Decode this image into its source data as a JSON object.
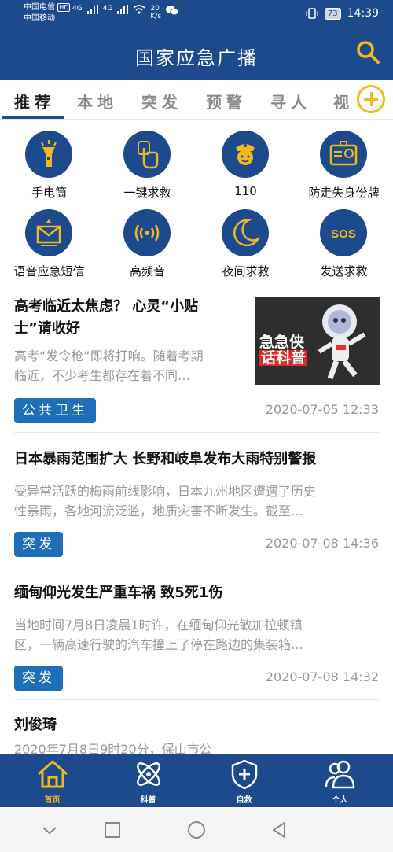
{
  "status_bar": {
    "carrier1": "中国电信",
    "carrier1_badge": "HD",
    "carrier2": "中国移动",
    "network1": "4G",
    "network2": "4G",
    "speed_value": "20",
    "speed_unit": "K/s",
    "battery": "73",
    "time": "14:39"
  },
  "header": {
    "title": "国家应急广播"
  },
  "tabs": [
    {
      "label": "推荐"
    },
    {
      "label": "本地"
    },
    {
      "label": "突发"
    },
    {
      "label": "预警"
    },
    {
      "label": "寻人"
    },
    {
      "label": "视"
    }
  ],
  "features": [
    {
      "label": "手电筒",
      "icon": "flashlight-icon"
    },
    {
      "label": "一键求救",
      "icon": "tap-hand-icon"
    },
    {
      "label": "110",
      "icon": "police-icon"
    },
    {
      "label": "防走失身份牌",
      "icon": "id-card-icon"
    },
    {
      "label": "语音应急短信",
      "icon": "voice-sms-icon"
    },
    {
      "label": "高频音",
      "icon": "high-frequency-sound-icon"
    },
    {
      "label": "夜间求救",
      "icon": "moon-icon"
    },
    {
      "label": "发送求救",
      "icon": "sos-icon"
    }
  ],
  "news": [
    {
      "title_line1": "高考临近太焦虑？ 心灵“小贴",
      "title_line2": "士”请收好",
      "summary_line1": "高考“发令枪”即将打响。随着考期",
      "summary_line2": "临近，不少考生都存在着不同…",
      "tag": "公共卫生",
      "date": "2020-07-05 12:33",
      "thumb_text_line1": "急急侠",
      "thumb_text_line2": "话科普"
    },
    {
      "title_line1": "日本暴雨范围扩大 长野和岐阜发布大雨特别警报",
      "summary_line1": "受异常活跃的梅雨前线影响，日本九州地区遭遇了历史",
      "summary_line2": "性暴雨，各地河流泛滥，地质灾害不断发生。截至…",
      "tag": "突发",
      "date": "2020-07-08 14:36"
    },
    {
      "title_line1": "缅甸仰光发生严重车祸 致5死1伤",
      "summary_line1": "当地时间7月8日凌晨1时许，在缅甸仰光敏加拉顿镇",
      "summary_line2": "区，一辆高速行驶的汽车撞上了停在路边的集装箱…",
      "tag": "突发",
      "date": "2020-07-08 14:32"
    },
    {
      "title_line1": "刘俊琦",
      "summary_line1": "2020年7月8日9时20分，保山市公"
    }
  ],
  "bottom_nav": [
    {
      "label": "首页",
      "icon": "home-icon"
    },
    {
      "label": "科普",
      "icon": "atom-icon"
    },
    {
      "label": "自救",
      "icon": "shield-plus-icon"
    },
    {
      "label": "个人",
      "icon": "users-icon"
    }
  ],
  "colors": {
    "primary": "#1d4a8c",
    "accent": "#f1b91f",
    "tag": "#1d6fba"
  }
}
